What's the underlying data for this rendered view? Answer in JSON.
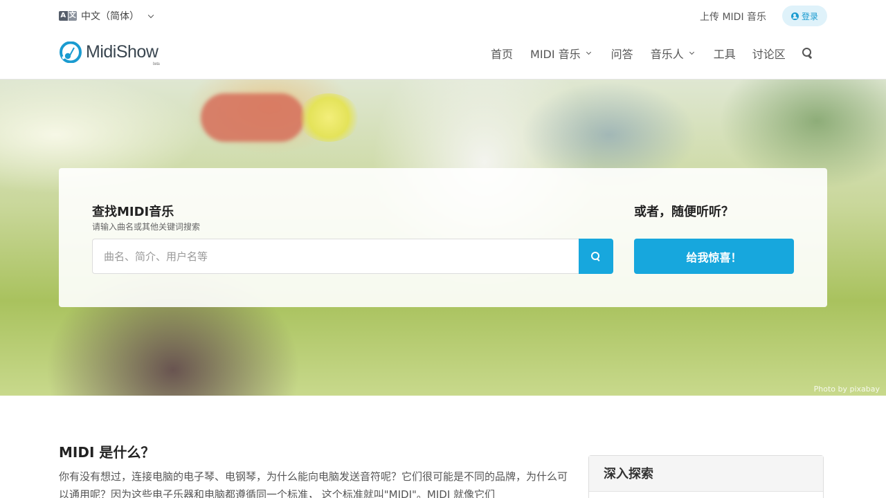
{
  "topbar": {
    "language": {
      "icon": "translate-icon",
      "icon_glyphs": [
        "A",
        "文"
      ],
      "label": "中文（简体）"
    },
    "upload_label": "上传 MIDI 音乐",
    "login": {
      "icon": "user-circle-icon",
      "label": "登录"
    }
  },
  "header": {
    "logo_text": "MidiShow",
    "logo_badge": "beta",
    "nav": [
      {
        "label": "首页",
        "has_dropdown": false
      },
      {
        "label": "MIDI 音乐",
        "has_dropdown": true
      },
      {
        "label": "问答",
        "has_dropdown": false
      },
      {
        "label": "音乐人",
        "has_dropdown": true
      },
      {
        "label": "工具",
        "has_dropdown": false
      },
      {
        "label": "讨论区",
        "has_dropdown": false
      }
    ],
    "search_icon": "search-icon"
  },
  "hero": {
    "photo_credit": "Photo by pixabay",
    "search": {
      "title": "查找MIDI音乐",
      "subtitle": "请输入曲名或其他关键词搜索",
      "placeholder": "曲名、简介、用户名等",
      "value": "",
      "button_icon": "search-icon"
    },
    "random": {
      "title": "或者，随便听听？",
      "button_label": "给我惊喜！"
    }
  },
  "content": {
    "section_title": "MIDI 是什么？",
    "section_text": "你有没有想过，连接电脑的电子琴、电钢琴，为什么能向电脑发送音符呢？它们很可能是不同的品牌，为什么可以通用呢？因为这些电子乐器和电脑都遵循同一个标准， 这个标准就叫\"MIDI\"。MIDI 就像它们",
    "sidebar_title": "深入探索"
  },
  "colors": {
    "accent": "#17a7dd",
    "login_bg": "#dff2fa",
    "login_text": "#1a9bd0"
  }
}
